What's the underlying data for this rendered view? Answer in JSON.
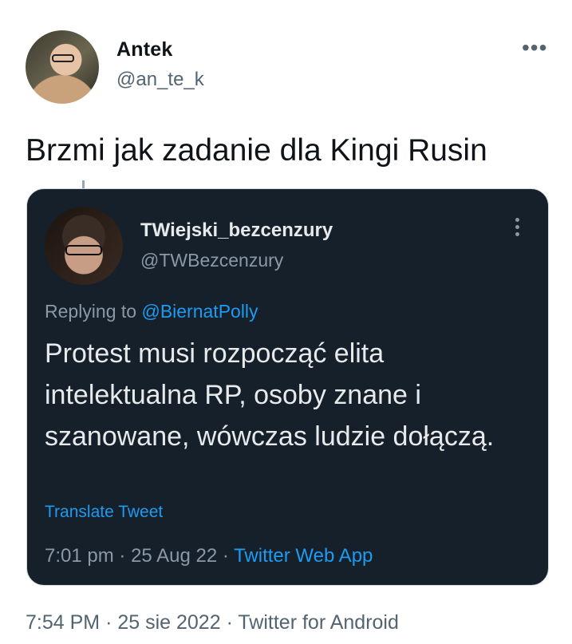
{
  "tweet": {
    "author_name": "Antek",
    "author_handle": "@an_te_k",
    "more_icon": "more-horizontal-icon",
    "text": "Brzmi jak zadanie dla Kingi Rusin",
    "time": "7:54 PM",
    "date": "25 sie 2022",
    "source": "Twitter for Android",
    "separator": "·"
  },
  "quoted": {
    "author_name": "TWiejski_bezcenzury",
    "author_handle": "@TWBezcenzury",
    "more_icon": "more-vertical-icon",
    "replying_prefix": "Replying to",
    "replying_to": "@BiernatPolly",
    "text": "Protest musi rozpocząć elita intelektualna RP, osoby znane i szanowane, wówczas ludzie dołączą.",
    "translate_label": "Translate Tweet",
    "time": "7:01 pm",
    "date": "25 Aug 22",
    "source": "Twitter Web App",
    "separator": "·"
  },
  "colors": {
    "card_background": "#15202b",
    "link": "#1d9bf0",
    "secondary_text": "#536471"
  }
}
